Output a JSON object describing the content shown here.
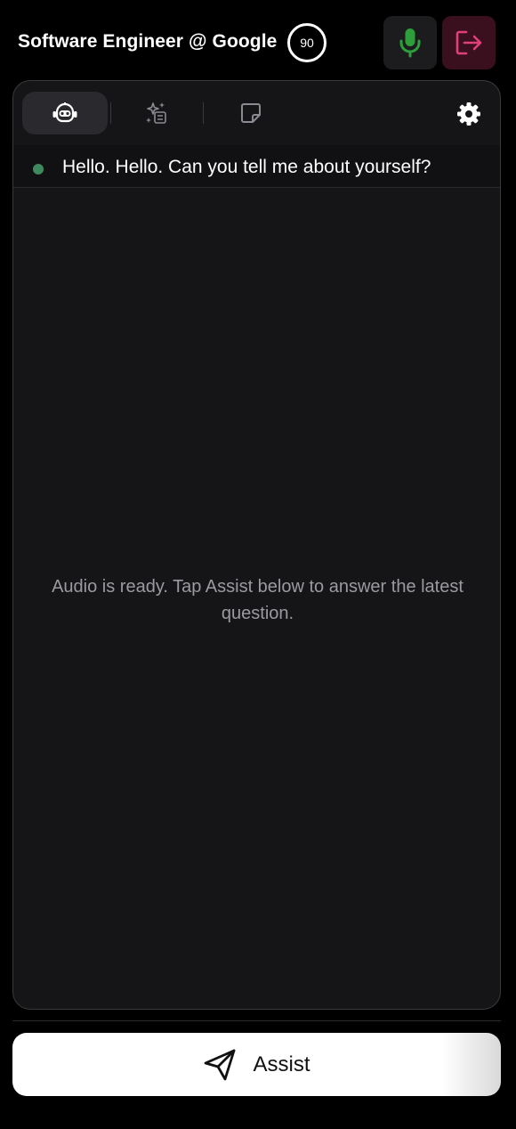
{
  "header": {
    "title": "Software Engineer @ Google",
    "score": "90"
  },
  "tabs": [
    {
      "icon": "robot-icon",
      "active": true
    },
    {
      "icon": "sparkle-list-icon",
      "active": false
    },
    {
      "icon": "note-icon",
      "active": false
    }
  ],
  "question": {
    "text": "Hello. Hello. Can you tell me about yourself?",
    "status_color": "#3e8a5e"
  },
  "empty_state": {
    "message": "Audio is ready. Tap Assist below to answer the latest question."
  },
  "assist": {
    "label": "Assist"
  },
  "colors": {
    "mic_green": "#2e9e3a",
    "exit_pink": "#e0407a",
    "background": "#000000",
    "panel": "#151518"
  }
}
